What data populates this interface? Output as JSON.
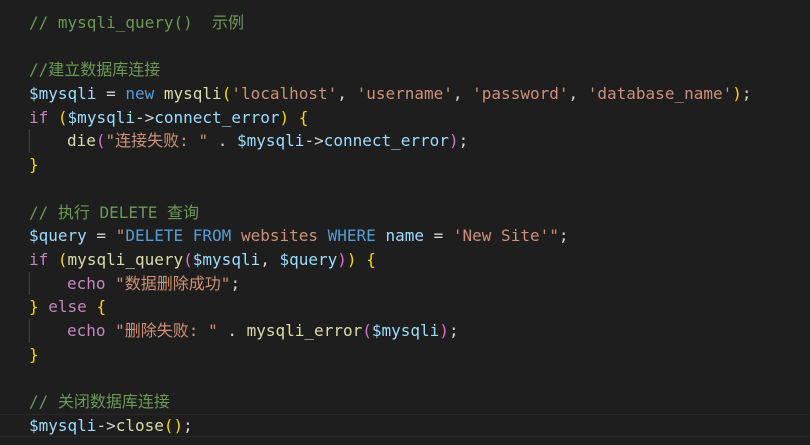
{
  "editor": {
    "language": "php",
    "theme_colors": {
      "background": "#1e1e1e",
      "comment": "#6a9955",
      "keyword": "#569cd6",
      "control": "#c586c0",
      "function": "#dcdcaa",
      "string": "#ce9178",
      "variable": "#9cdcfe"
    },
    "lines": [
      [
        {
          "t": "comment",
          "v": "// mysqli_query()  示例"
        }
      ],
      [],
      [
        {
          "t": "comment",
          "v": "//建立数据库连接"
        }
      ],
      [
        {
          "t": "var",
          "v": "$mysqli"
        },
        {
          "t": "op",
          "v": " = "
        },
        {
          "t": "kw",
          "v": "new"
        },
        {
          "t": "op",
          "v": " "
        },
        {
          "t": "fn",
          "v": "mysqli"
        },
        {
          "t": "b1",
          "v": "("
        },
        {
          "t": "str",
          "v": "'localhost'"
        },
        {
          "t": "punc",
          "v": ", "
        },
        {
          "t": "str",
          "v": "'username'"
        },
        {
          "t": "punc",
          "v": ", "
        },
        {
          "t": "str",
          "v": "'password'"
        },
        {
          "t": "punc",
          "v": ", "
        },
        {
          "t": "str",
          "v": "'database_name'"
        },
        {
          "t": "b1",
          "v": ")"
        },
        {
          "t": "punc",
          "v": ";"
        }
      ],
      [
        {
          "t": "ctl",
          "v": "if"
        },
        {
          "t": "op",
          "v": " "
        },
        {
          "t": "b1",
          "v": "("
        },
        {
          "t": "var",
          "v": "$mysqli"
        },
        {
          "t": "op",
          "v": "->"
        },
        {
          "t": "prop",
          "v": "connect_error"
        },
        {
          "t": "b1",
          "v": ")"
        },
        {
          "t": "op",
          "v": " "
        },
        {
          "t": "b1",
          "v": "{"
        }
      ],
      [
        {
          "t": "indent",
          "v": ""
        },
        {
          "t": "fn",
          "v": "die"
        },
        {
          "t": "b2",
          "v": "("
        },
        {
          "t": "str",
          "v": "\"连接失败: \""
        },
        {
          "t": "op",
          "v": " . "
        },
        {
          "t": "var",
          "v": "$mysqli"
        },
        {
          "t": "op",
          "v": "->"
        },
        {
          "t": "prop",
          "v": "connect_error"
        },
        {
          "t": "b2",
          "v": ")"
        },
        {
          "t": "punc",
          "v": ";"
        }
      ],
      [
        {
          "t": "b1",
          "v": "}"
        }
      ],
      [],
      [
        {
          "t": "comment",
          "v": "// 执行 DELETE 查询"
        }
      ],
      [
        {
          "t": "var",
          "v": "$query"
        },
        {
          "t": "op",
          "v": " = "
        },
        {
          "t": "str",
          "v": "\""
        },
        {
          "t": "sql",
          "v": "DELETE FROM"
        },
        {
          "t": "ident",
          "v": " websites "
        },
        {
          "t": "sql",
          "v": "WHERE"
        },
        {
          "t": "ident",
          "v": " "
        },
        {
          "t": "var",
          "v": "name"
        },
        {
          "t": "op",
          "v": " = "
        },
        {
          "t": "str",
          "v": "'New Site'"
        },
        {
          "t": "str",
          "v": "\""
        },
        {
          "t": "punc",
          "v": ";"
        }
      ],
      [
        {
          "t": "ctl",
          "v": "if"
        },
        {
          "t": "op",
          "v": " "
        },
        {
          "t": "b1",
          "v": "("
        },
        {
          "t": "fn",
          "v": "mysqli_query"
        },
        {
          "t": "b2",
          "v": "("
        },
        {
          "t": "var",
          "v": "$mysqli"
        },
        {
          "t": "punc",
          "v": ", "
        },
        {
          "t": "var",
          "v": "$query"
        },
        {
          "t": "b2",
          "v": ")"
        },
        {
          "t": "b1",
          "v": ")"
        },
        {
          "t": "op",
          "v": " "
        },
        {
          "t": "b1",
          "v": "{"
        }
      ],
      [
        {
          "t": "indent",
          "v": ""
        },
        {
          "t": "ctl",
          "v": "echo"
        },
        {
          "t": "op",
          "v": " "
        },
        {
          "t": "str",
          "v": "\"数据删除成功\""
        },
        {
          "t": "punc",
          "v": ";"
        }
      ],
      [
        {
          "t": "b1",
          "v": "}"
        },
        {
          "t": "op",
          "v": " "
        },
        {
          "t": "ctl",
          "v": "else"
        },
        {
          "t": "op",
          "v": " "
        },
        {
          "t": "b1",
          "v": "{"
        }
      ],
      [
        {
          "t": "indent",
          "v": ""
        },
        {
          "t": "ctl",
          "v": "echo"
        },
        {
          "t": "op",
          "v": " "
        },
        {
          "t": "str",
          "v": "\"删除失败: \""
        },
        {
          "t": "op",
          "v": " . "
        },
        {
          "t": "fn",
          "v": "mysqli_error"
        },
        {
          "t": "b2",
          "v": "("
        },
        {
          "t": "var",
          "v": "$mysqli"
        },
        {
          "t": "b2",
          "v": ")"
        },
        {
          "t": "punc",
          "v": ";"
        }
      ],
      [
        {
          "t": "b1",
          "v": "}"
        }
      ],
      [],
      [
        {
          "t": "comment",
          "v": "// 关闭数据库连接"
        }
      ],
      [
        {
          "t": "var",
          "v": "$mysqli"
        },
        {
          "t": "op",
          "v": "->"
        },
        {
          "t": "fn",
          "v": "close"
        },
        {
          "t": "b1",
          "v": "()"
        },
        {
          "t": "punc",
          "v": ";"
        }
      ]
    ],
    "current_line": 17,
    "indent_guide_lines": [
      5,
      11,
      13
    ]
  }
}
